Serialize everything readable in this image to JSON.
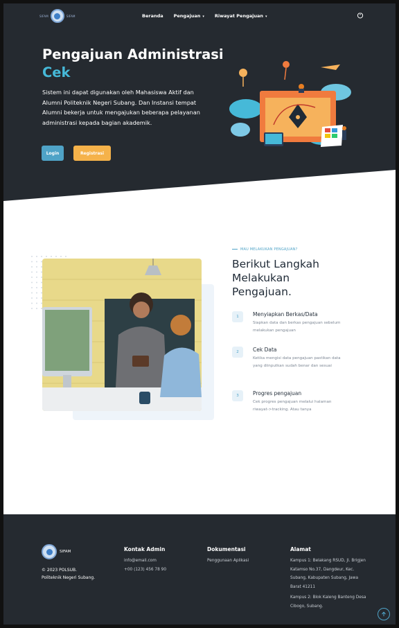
{
  "nav": {
    "logo_left": "SIFAM",
    "logo_right": "SIFAM",
    "links": [
      {
        "label": "Beranda",
        "caret": ""
      },
      {
        "label": "Pengajuan",
        "caret": "▾"
      },
      {
        "label": "Riwayat Pengajuan",
        "caret": "▾"
      }
    ],
    "power_icon": "power-icon"
  },
  "hero": {
    "title": "Pengajuan Administrasi",
    "subtitle": "Cek",
    "description": "Sistem ini dapat digunakan oleh Mahasiswa Aktif dan Alumni Politeknik Negeri Subang. Dan Instansi tempat Alumni bekerja untuk mengajukan beberapa pelayanan administrasi kepada bagian akademik.",
    "login_label": "Login",
    "register_label": "Registrasi"
  },
  "steps": {
    "eyebrow": "MAU MELAKUKAN PENGAJUAN?",
    "title": "Berikut Langkah Melakukan Pengajuan.",
    "items": [
      {
        "num": "1",
        "title": "Menyiapkan Berkas/Data",
        "text": "Siapkan data dan berkas pengajuan sebelum melakukan pengajuan"
      },
      {
        "num": "2",
        "title": "Cek Data",
        "text": "Ketika mengisi data pengajuan pastikan data yang diinputkan sudah benar dan sesuai"
      },
      {
        "num": "3",
        "title": "Progres pengajuan",
        "text": "Cek progres pengajuan melalui halaman riwayat->tracking. Atau tanya"
      }
    ]
  },
  "footer": {
    "logo_text": "SIFAM",
    "copyright": "© 2023 POLSUB.",
    "org": "Politeknik Negeri Subang.",
    "contact_head": "Kontak Admin",
    "email": "info@email.com",
    "phone": "+00 (123) 456 78 90",
    "docs_head": "Dokumentasi",
    "docs_link": "Penggunaan Aplikasi",
    "address_head": "Alamat",
    "address1": "Kampus 1: Belakang RSUD, Jl. Brigjen Katamso No.37, Dangdeur, Kec. Subang, Kabupaten Subang, Jawa Barat 41211",
    "address2": "Kampus 2: Blok Kaleng Banteng Desa Cibogo, Subang."
  },
  "colors": {
    "dark_bg": "#252a30",
    "accent_blue": "#4fa3c7",
    "accent_cyan": "#46b9d8",
    "accent_orange": "#f5b24a"
  }
}
